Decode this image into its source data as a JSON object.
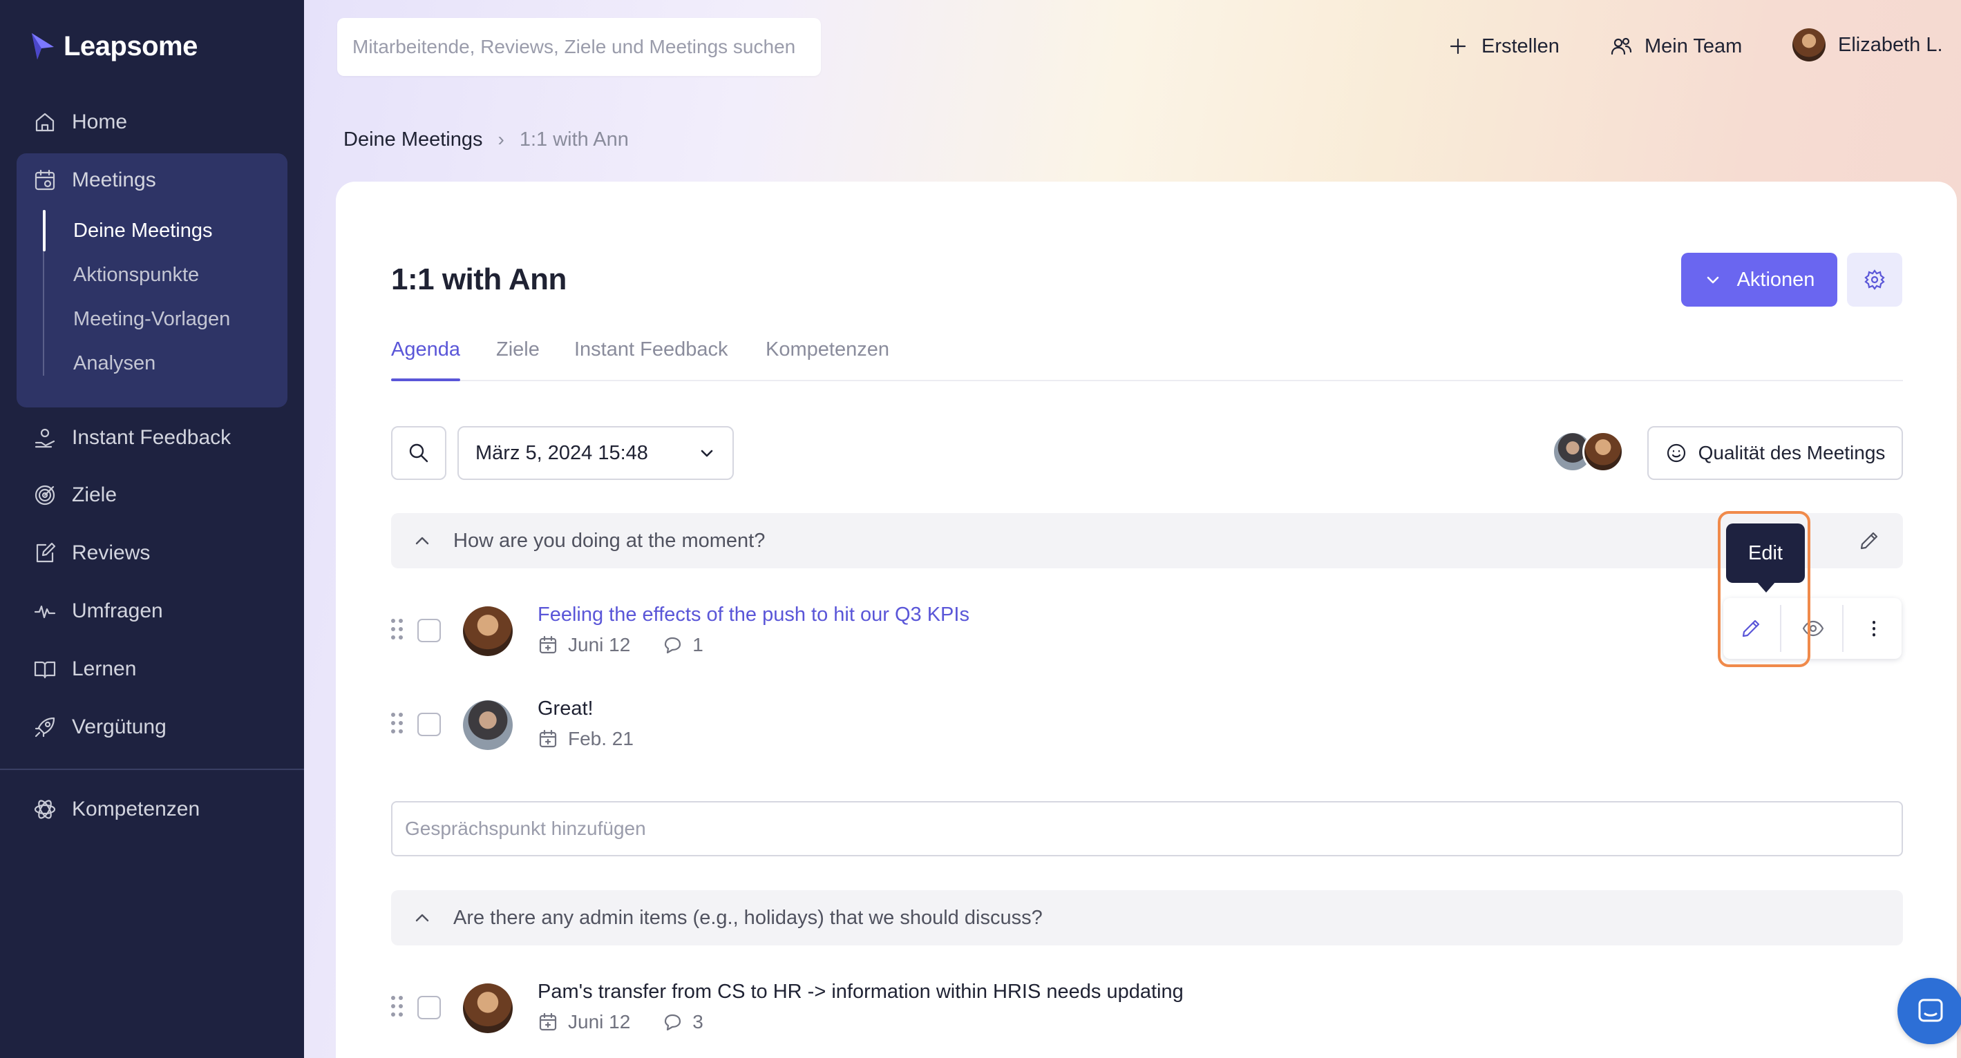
{
  "app": {
    "name": "Leapsome",
    "brand_color": "#6a66f0",
    "sidebar_bg": "#1e2240"
  },
  "sidebar": {
    "items": [
      {
        "label": "Home",
        "icon": "home-icon"
      },
      {
        "label": "Meetings",
        "icon": "meetings-icon"
      },
      {
        "label": "Instant Feedback",
        "icon": "instant-feedback-icon"
      },
      {
        "label": "Ziele",
        "icon": "target-icon"
      },
      {
        "label": "Reviews",
        "icon": "edit-square-icon"
      },
      {
        "label": "Umfragen",
        "icon": "pulse-icon"
      },
      {
        "label": "Lernen",
        "icon": "book-icon"
      },
      {
        "label": "Vergütung",
        "icon": "rocket-icon"
      },
      {
        "label": "Kompetenzen",
        "icon": "atom-icon"
      }
    ],
    "meetings_sub": [
      "Deine Meetings",
      "Aktionspunkte",
      "Meeting-Vorlagen",
      "Analysen"
    ]
  },
  "topbar": {
    "search_placeholder": "Mitarbeitende, Reviews, Ziele und Meetings suchen",
    "create_label": "Erstellen",
    "team_label": "Mein Team",
    "user_name": "Elizabeth L."
  },
  "breadcrumb": {
    "parent": "Deine Meetings",
    "separator": "›",
    "current": "1:1 with Ann"
  },
  "meeting": {
    "title": "1:1 with Ann",
    "actions_label": "Aktionen",
    "tabs": [
      "Agenda",
      "Ziele",
      "Instant Feedback",
      "Kompetenzen"
    ],
    "active_tab": "Agenda",
    "date": "März 5, 2024 15:48",
    "quality_label": "Qualität des Meetings"
  },
  "agenda": {
    "sections": [
      {
        "question": "How are you doing at the moment?",
        "items": [
          {
            "title": "Feeling the effects of the push to hit our Q3 KPIs",
            "date": "Juni 12",
            "comments": "1"
          },
          {
            "title": "Great!",
            "date": "Feb. 21"
          }
        ]
      },
      {
        "question": "Are there any admin items (e.g., holidays) that we should discuss?",
        "items": [
          {
            "title": "Pam's transfer from CS to HR -> information within HRIS needs updating",
            "date": "Juni 12",
            "comments": "3"
          }
        ]
      }
    ],
    "add_placeholder": "Gesprächspunkt hinzufügen"
  },
  "tooltip": {
    "label": "Edit"
  }
}
